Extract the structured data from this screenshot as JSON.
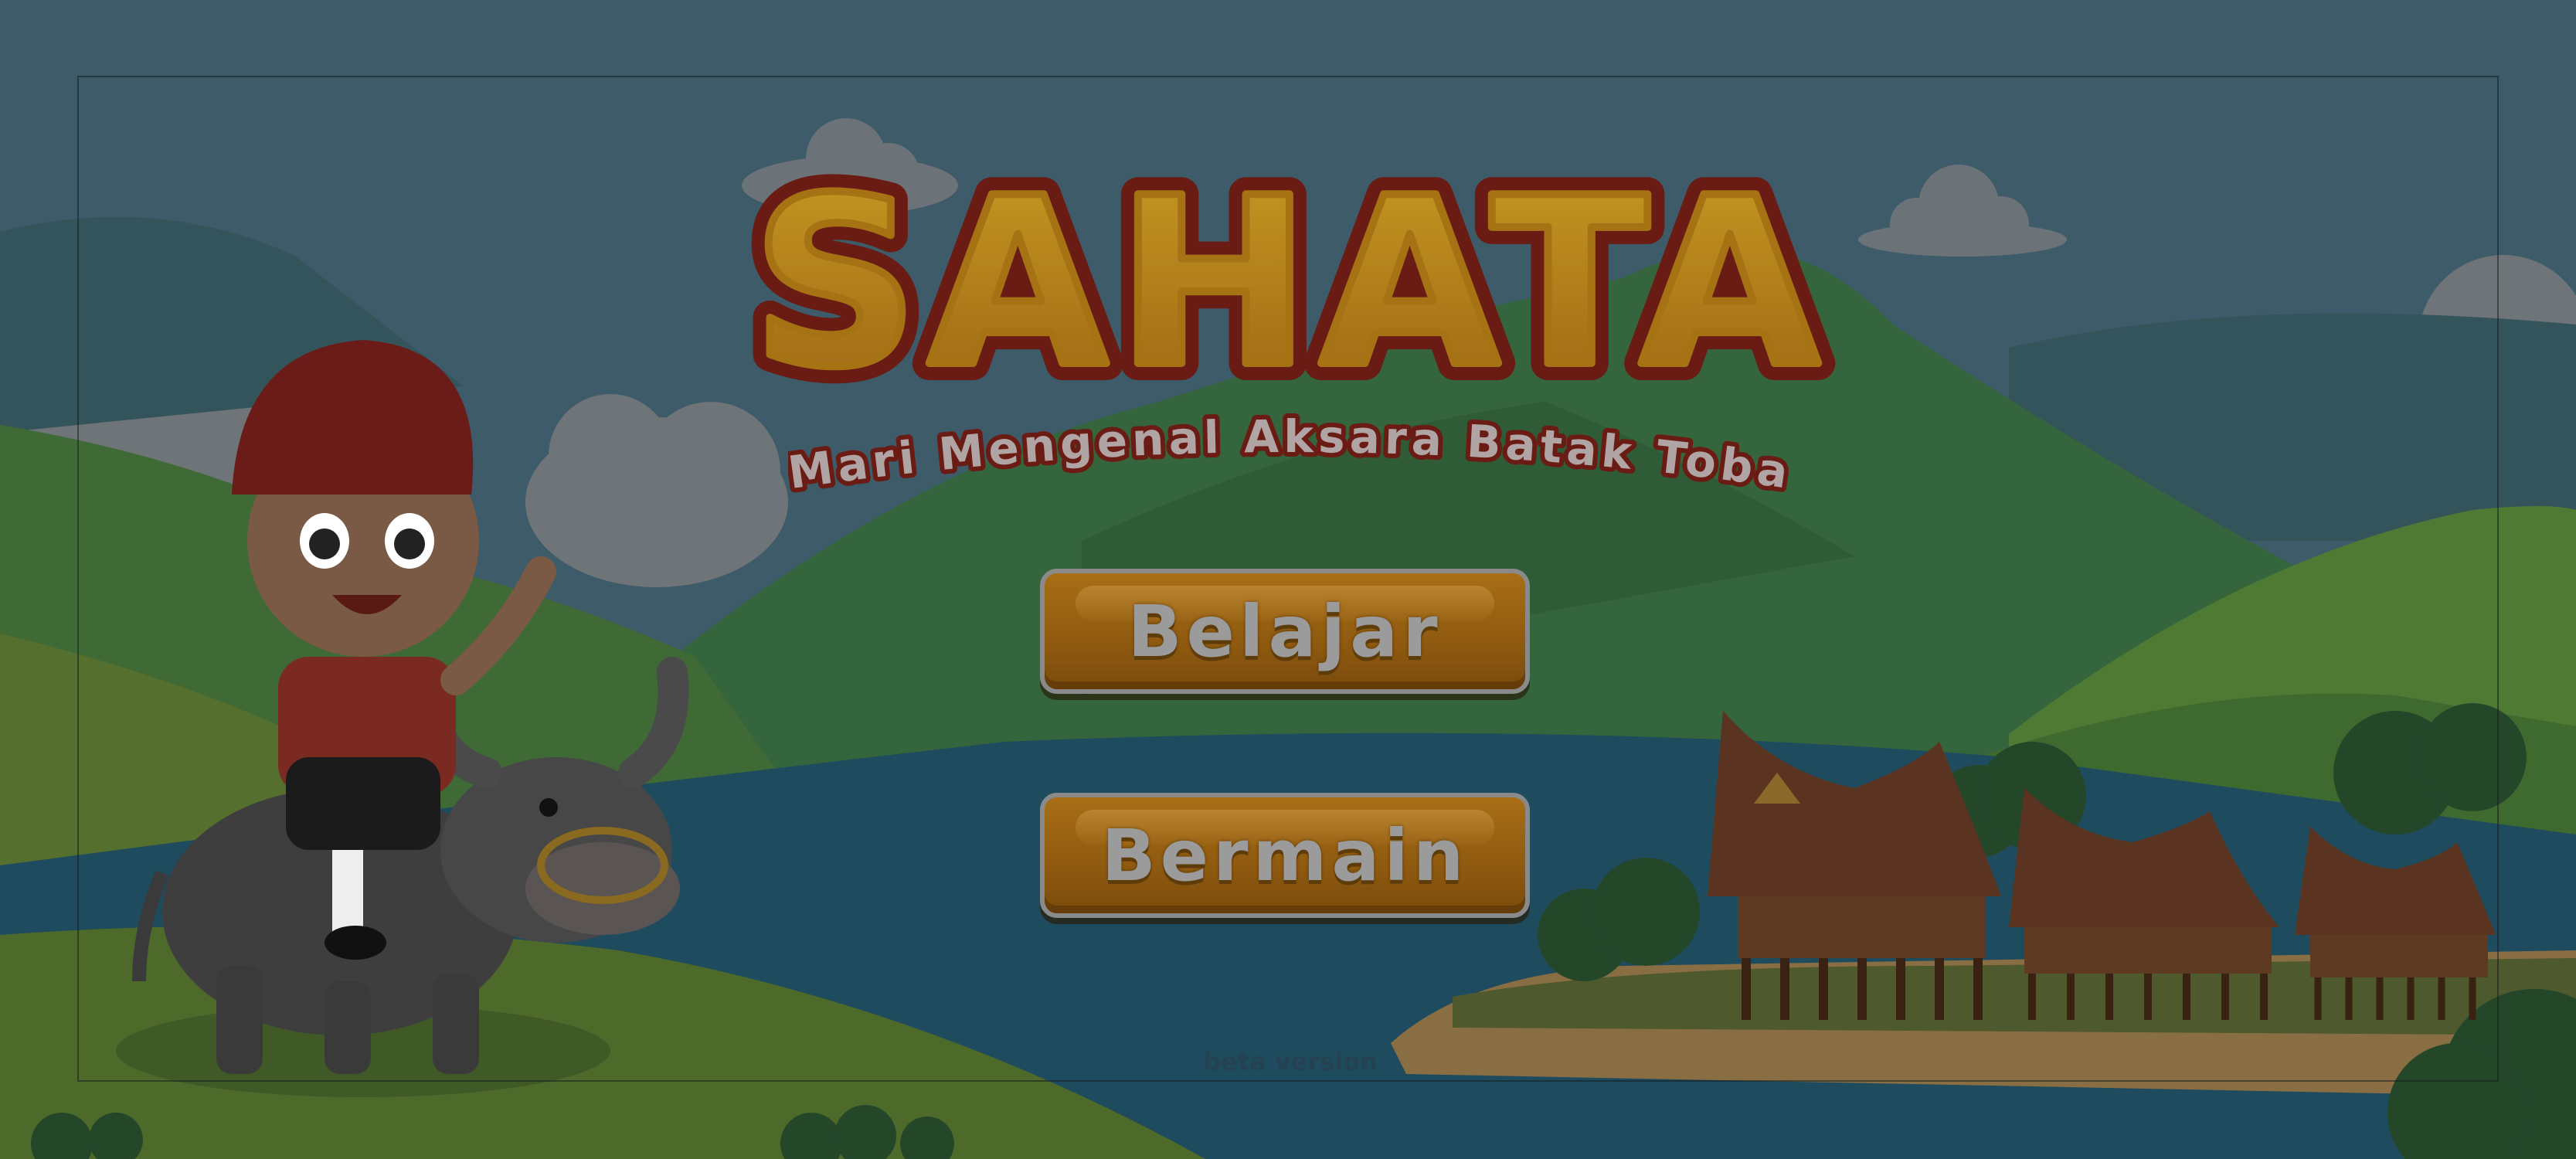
{
  "game": {
    "title": "SAHATA",
    "subtitle": "Mari Mengenal Aksara Batak Toba",
    "menu": {
      "learn_label": "Belajar",
      "play_label": "Bermain"
    },
    "version_label": "beta version"
  },
  "colors": {
    "sky": "#3c5a68",
    "title_fill": "#b78a1c",
    "title_outline": "#7a1f14",
    "button_fill": "#9a6212",
    "button_text": "#9b9b9b",
    "lake": "#1f4b5f",
    "grass": "#3f5a2e"
  },
  "icons": [
    "cloud-icon",
    "mountain-icon",
    "batak-house-icon",
    "boy-character-icon",
    "water-buffalo-icon"
  ]
}
